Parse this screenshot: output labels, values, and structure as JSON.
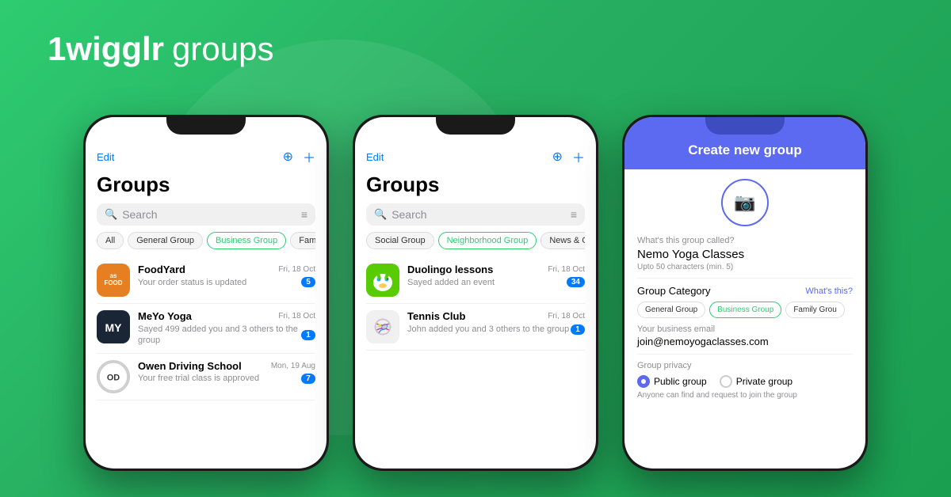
{
  "logo": {
    "icon": "⌘",
    "brand": "1wigglr",
    "product": "groups"
  },
  "phone1": {
    "topBar": {
      "edit": "Edit",
      "icons": [
        "compass",
        "plus"
      ]
    },
    "title": "Groups",
    "search": {
      "placeholder": "Search"
    },
    "filterTabs": [
      {
        "label": "All",
        "active": false
      },
      {
        "label": "General Group",
        "active": false
      },
      {
        "label": "Business Group",
        "active": true
      },
      {
        "label": "Family G",
        "active": false
      }
    ],
    "groups": [
      {
        "name": "FoodYard",
        "date": "Fri, 18 Oct",
        "message": "Your order status is updated",
        "badge": "5",
        "avatarColor": "orange",
        "avatarText": "FOOD"
      },
      {
        "name": "MeYo Yoga",
        "date": "Fri, 18 Oct",
        "message": "Sayed 499 added you and 3 others to the group",
        "badge": "1",
        "avatarColor": "dark",
        "avatarText": "MY"
      },
      {
        "name": "Owen Driving School",
        "date": "Mon, 19 Aug",
        "message": "Your free trial class is approved",
        "badge": "7",
        "avatarColor": "circle",
        "avatarText": "OD"
      }
    ]
  },
  "phone2": {
    "topBar": {
      "edit": "Edit",
      "icons": [
        "compass",
        "plus"
      ]
    },
    "title": "Groups",
    "search": {
      "placeholder": "Search"
    },
    "filterTabs": [
      {
        "label": "Social Group",
        "active": false
      },
      {
        "label": "Neighborhood Group",
        "active": true
      },
      {
        "label": "News & Gossip G",
        "active": false
      }
    ],
    "groups": [
      {
        "name": "Duolingo lessons",
        "date": "Fri, 18 Oct",
        "message": "Sayed added an event",
        "badge": "34",
        "avatarType": "duolingo"
      },
      {
        "name": "Tennis Club",
        "date": "Fri, 18 Oct",
        "message": "John added you and 3 others to the group",
        "badge": "1",
        "avatarType": "tennis"
      }
    ]
  },
  "phone3": {
    "header": "Create new group",
    "photoLabel": "📷",
    "form": {
      "groupNameLabel": "What's this group called?",
      "groupNameValue": "Nemo Yoga Classes",
      "groupNameHint": "Upto 50 characters (min. 5)",
      "categoryLabel": "Group Category",
      "categoryLink": "What's this?",
      "categoryTabs": [
        {
          "label": "General Group",
          "active": false
        },
        {
          "label": "Business Group",
          "active": true
        },
        {
          "label": "Family Grou",
          "active": false
        }
      ],
      "emailLabel": "Your business email",
      "emailValue": "join@nemoyogaclasses.com",
      "privacyLabel": "Group privacy",
      "privacyOptions": [
        {
          "label": "Public group",
          "selected": true
        },
        {
          "label": "Private group",
          "selected": false
        }
      ],
      "privacyHint": "Anyone can find and request to join the group"
    }
  }
}
